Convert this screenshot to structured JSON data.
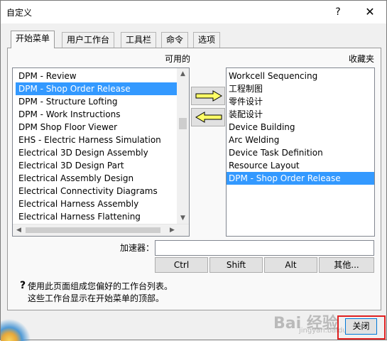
{
  "window": {
    "title": "自定义",
    "help_glyph": "?",
    "close_glyph": "✕"
  },
  "tabs": [
    {
      "label": "开始菜单",
      "active": true
    },
    {
      "label": "用户工作台",
      "active": false
    },
    {
      "label": "工具栏",
      "active": false
    },
    {
      "label": "命令",
      "active": false
    },
    {
      "label": "选项",
      "active": false
    }
  ],
  "available": {
    "label": "可用的",
    "items": [
      "DPM - Review",
      "DPM - Shop Order Release",
      "DPM - Structure Lofting",
      "DPM - Work Instructions",
      "DPM Shop Floor Viewer",
      "EHS - Electric Harness Simulation",
      "Electrical 3D Design Assembly",
      "Electrical 3D Design Part",
      "Electrical Assembly Design",
      "Electrical Connectivity Diagrams",
      "Electrical Harness Assembly",
      "Electrical Harness Flattening"
    ],
    "selected_index": 1
  },
  "favorites": {
    "label": "收藏夹",
    "items": [
      "Workcell Sequencing",
      "工程制图",
      "零件设计",
      "装配设计",
      "Device Building",
      "Arc Welding",
      "Device Task Definition",
      "Resource Layout",
      "DPM - Shop Order Release"
    ],
    "selected_index": 8
  },
  "accelerator": {
    "label": "加速器：",
    "value": ""
  },
  "modifier_buttons": {
    "ctrl": "Ctrl",
    "shift": "Shift",
    "alt": "Alt",
    "other": "其他..."
  },
  "help": {
    "icon": "?",
    "line1": "使用此页面组成您偏好的工作台列表。",
    "line2": "这些工作台显示在开始菜单的顶部。"
  },
  "close_button": "关闭",
  "watermark": {
    "text": "Bai 经验",
    "sub": "jingyan.baidu.com"
  },
  "colors": {
    "selection": "#3399ff",
    "highlight_frame": "#e02020",
    "arrow_fill": "#ffff66"
  }
}
